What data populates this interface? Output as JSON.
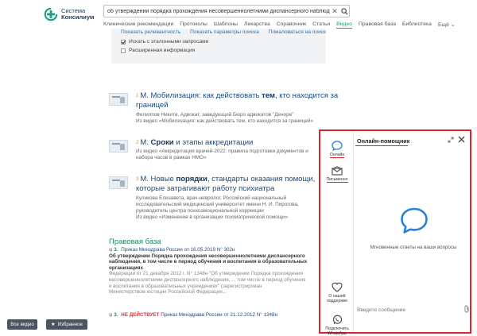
{
  "header": {
    "logo_line1": "Система",
    "logo_line2": "Консилиум",
    "search_value": "об утверждении порядка прохождения несовершеннолетними диспансерного наблюдения, в т...",
    "nav": [
      "Клинические рекомендации",
      "Протоколы",
      "Шаблоны",
      "Лекарства",
      "Справочник",
      "Статьи",
      "Видео",
      "Правовая база",
      "Библиотека",
      "Ещё"
    ],
    "nav_active_index": 6
  },
  "filters": {
    "links": [
      "Показать релевантность",
      "Показать параметры поиска",
      "Пожаловаться на поиск"
    ],
    "option_1": "Искать с эталонными запросами",
    "option_1_checked": true,
    "option_2": "Расширенная информация",
    "option_2_checked": false
  },
  "results": [
    {
      "num": "1",
      "title_pre": "М. Мобилизация: как действовать ",
      "title_bold": "тем",
      "title_post": ", кто находится за границей",
      "meta": [
        "Филиппов Никита, Адвокат, заведующий Бюро адвокатов \"Деноре\"",
        "Из видео «Мобилизация: как действовать тем, кто находится за границей»"
      ]
    },
    {
      "num": "2",
      "title_pre": "М. ",
      "title_bold": "Сроки",
      "title_post": " и этапы аккредитации",
      "meta": [
        "Из видео «Аккредитация врачей-2022: правила подготовки документов и",
        "набора часов в рамках НМО»"
      ]
    },
    {
      "num": "3",
      "title_pre": "М. Новые ",
      "title_bold": "порядки",
      "title_post": ", стандарты оказания помощи, которые затрагивают работу психиатра",
      "meta": [
        "Куликова Елизавета, врач-невролог, Российский национальный",
        "исследовательский медицинский университет имени Н. И. Пирогова,",
        "руководитель центра психоэмоциональной коррекции",
        "Из видео «Изменения в организации психиатрической помощи»"
      ]
    }
  ],
  "law_section": {
    "heading": "Правовая база",
    "items": [
      {
        "badge": "3.",
        "status": "",
        "head": "Приказ Минздрава России от 16.05.2019 N° 302н",
        "bold_1": "Об утверждении Порядка прохождения несовершеннолетними диспансерного",
        "text_1": "наблюдения, в том числе в период обучения и воспитания в образовательных",
        "text_2": "организациях",
        "grey_1": "Федерации от 21 декабря 2012 г. N° 1348н \"Об утверждении Порядка прохождения",
        "grey_2": "несовершеннолетними диспансерного наблюдения, ... том числе в период обучения",
        "grey_3": "и воспитания в образовательных учреждениях\" (зарегистрирован",
        "grey_4": "Министерством юстиции Российской Федерации..."
      },
      {
        "badge": "3.",
        "status": "НЕ ДЕЙСТВУЕТ",
        "head": "Приказ Минздрава России от 21.12.2012 N° 1348н",
        "bold_1": "",
        "text_1": "",
        "text_2": "",
        "grey_1": "",
        "grey_2": "",
        "grey_3": "",
        "grey_4": ""
      }
    ]
  },
  "chat": {
    "title": "Онлайн-помощник",
    "tab_online": "Онлайн",
    "tab_written": "Письменно",
    "tab_support": "О нашей поддержке",
    "tab_whatsapp": "Подключить WhatsApp",
    "tagline": "Мгновенные ответы на ваши вопросы",
    "input_placeholder": "Введите сообщение"
  },
  "bottom": {
    "all_video": "Все видео",
    "favorites": "Избранное"
  },
  "colors": {
    "brand_green": "#1f9e84",
    "link_blue": "#1b4b7d",
    "accent_red": "#d9232d",
    "chat_blue": "#2a7fd8"
  }
}
